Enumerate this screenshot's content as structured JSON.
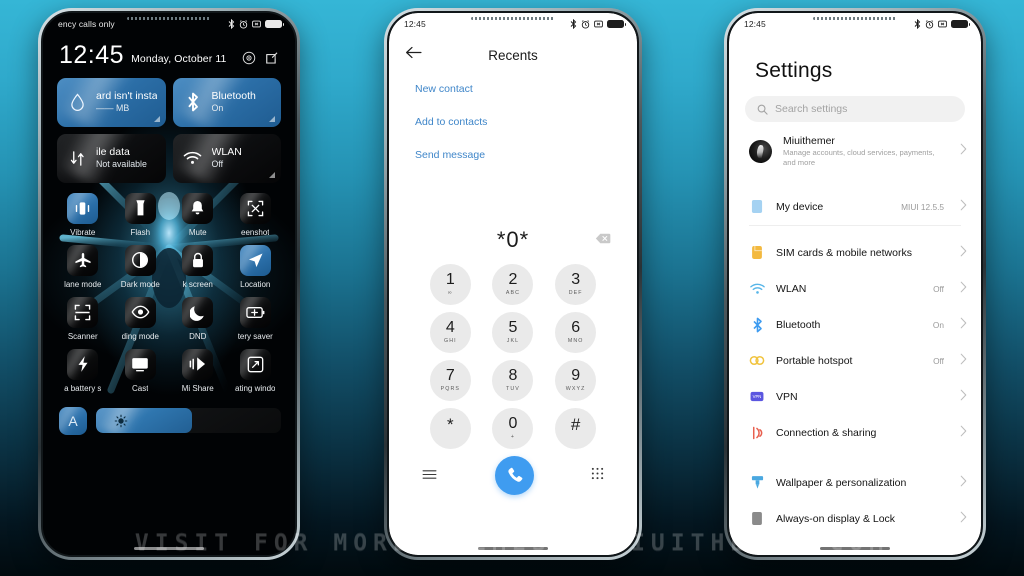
{
  "background": {
    "top_color": "#35b6d6",
    "bottom_color": "#010a0e"
  },
  "watermark": {
    "text": "VISIT FOR MORE THEMES - MIUITHEMER.COM"
  },
  "phone1": {
    "status_bar": {
      "carrier": "ency calls only",
      "icons": [
        "bluetooth-icon",
        "alarm-icon",
        "vibrate-icon",
        "battery-icon"
      ]
    },
    "header": {
      "time": "12:45",
      "date": "Monday, October 11",
      "icons": [
        "settings-gear-icon",
        "edit-icon"
      ]
    },
    "big_tiles": [
      {
        "title": "ard isn't install",
        "subtitle": "—— MB",
        "icon": "data-usage-drop-icon",
        "state": "on"
      },
      {
        "title": "Bluetooth",
        "subtitle": "On",
        "icon": "bluetooth-icon",
        "state": "on"
      },
      {
        "title": "ile data",
        "subtitle": "Not available",
        "icon": "mobile-data-icon",
        "state": "off"
      },
      {
        "title": "WLAN",
        "subtitle": "Off",
        "icon": "wifi-icon",
        "state": "off"
      }
    ],
    "toggles": [
      {
        "label": "Vibrate",
        "icon": "vibrate-icon",
        "state": "on"
      },
      {
        "label": "Flash",
        "icon": "flashlight-icon",
        "state": "off"
      },
      {
        "label": "Mute",
        "icon": "bell-mute-icon",
        "state": "off"
      },
      {
        "label": "eenshot",
        "icon": "screenshot-icon",
        "state": "off"
      },
      {
        "label": "lane mode",
        "icon": "airplane-icon",
        "state": "off"
      },
      {
        "label": "Dark mode",
        "icon": "dark-mode-icon",
        "state": "off"
      },
      {
        "label": "k screen",
        "icon": "lock-icon",
        "state": "off"
      },
      {
        "label": "Location",
        "icon": "location-arrow-icon",
        "state": "on"
      },
      {
        "label": "Scanner",
        "icon": "scanner-icon",
        "state": "off"
      },
      {
        "label": "ding mode",
        "icon": "reading-mode-eye-icon",
        "state": "off"
      },
      {
        "label": "DND",
        "icon": "moon-icon",
        "state": "off"
      },
      {
        "label": "tery saver",
        "icon": "battery-saver-icon",
        "state": "off"
      },
      {
        "label": "a battery s",
        "icon": "ultra-battery-bolt-icon",
        "state": "off"
      },
      {
        "label": "Cast",
        "icon": "cast-icon",
        "state": "off"
      },
      {
        "label": "Mi Share",
        "icon": "mi-share-icon",
        "state": "off"
      },
      {
        "label": "ating windo",
        "icon": "floating-window-icon",
        "state": "off"
      }
    ],
    "brightness": {
      "auto_label": "A",
      "level_percent": 52
    }
  },
  "phone2": {
    "status_bar": {
      "time": "12:45",
      "icons": [
        "bluetooth-icon",
        "alarm-icon",
        "vibrate-icon",
        "battery-icon"
      ]
    },
    "title": "Recents",
    "back_icon": "back-arrow-icon",
    "links": [
      "New contact",
      "Add to contacts",
      "Send message"
    ],
    "dialed_number": "*0*",
    "delete_icon": "backspace-icon",
    "keys": [
      {
        "digit": "1",
        "sub": "∞"
      },
      {
        "digit": "2",
        "sub": "ABC"
      },
      {
        "digit": "3",
        "sub": "DEF"
      },
      {
        "digit": "4",
        "sub": "GHI"
      },
      {
        "digit": "5",
        "sub": "JKL"
      },
      {
        "digit": "6",
        "sub": "MNO"
      },
      {
        "digit": "7",
        "sub": "PQRS"
      },
      {
        "digit": "8",
        "sub": "TUV"
      },
      {
        "digit": "9",
        "sub": "WXYZ"
      },
      {
        "digit": "*",
        "sub": ""
      },
      {
        "digit": "0",
        "sub": "+"
      },
      {
        "digit": "#",
        "sub": ""
      }
    ],
    "bottom_bar": {
      "menu_icon": "hamburger-menu-icon",
      "call_icon": "phone-call-icon",
      "keypad_icon": "dialpad-icon",
      "call_button_color": "#3f9cf0"
    }
  },
  "phone3": {
    "status_bar": {
      "time": "12:45",
      "icons": [
        "bluetooth-icon",
        "alarm-icon",
        "vibrate-icon",
        "battery-icon"
      ]
    },
    "title": "Settings",
    "search": {
      "placeholder": "Search settings",
      "icon": "search-icon"
    },
    "account": {
      "name": "Miuithemer",
      "subtitle": "Manage accounts, cloud services, payments, and more",
      "avatar": "user-avatar"
    },
    "rows": [
      {
        "label": "My device",
        "value": "MIUI 12.5.5",
        "icon": "device-icon",
        "color": "#a5d2f2"
      },
      {
        "label": "SIM cards & mobile networks",
        "value": "",
        "icon": "sim-card-icon",
        "color": "#f3b93f"
      },
      {
        "label": "WLAN",
        "value": "Off",
        "icon": "wifi-icon",
        "color": "#57b5e8"
      },
      {
        "label": "Bluetooth",
        "value": "On",
        "icon": "bluetooth-icon",
        "color": "#3d9bf0"
      },
      {
        "label": "Portable hotspot",
        "value": "Off",
        "icon": "hotspot-icon",
        "color": "#f1c43f"
      },
      {
        "label": "VPN",
        "value": "",
        "icon": "vpn-icon",
        "color": "#5b56e0"
      },
      {
        "label": "Connection & sharing",
        "value": "",
        "icon": "connection-sharing-icon",
        "color": "#e8604f"
      },
      {
        "label": "Wallpaper & personalization",
        "value": "",
        "icon": "wallpaper-brush-icon",
        "color": "#4aa8e0"
      },
      {
        "label": "Always-on display & Lock",
        "value": "",
        "icon": "aod-lock-icon",
        "color": "#8a8a8a"
      }
    ],
    "chevron_icon": "chevron-right-icon"
  }
}
